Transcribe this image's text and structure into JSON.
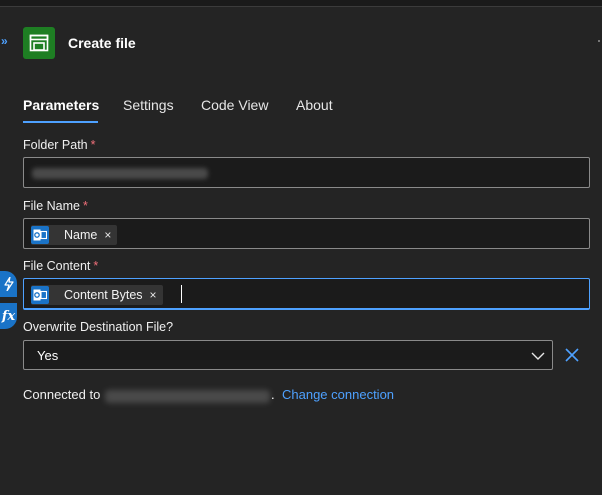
{
  "header": {
    "title": "Create file",
    "app_icon": "file-folder-icon",
    "collapse_icon": "double-chevron-icon"
  },
  "tabs": [
    {
      "label": "Parameters",
      "active": true
    },
    {
      "label": "Settings",
      "active": false
    },
    {
      "label": "Code View",
      "active": false
    },
    {
      "label": "About",
      "active": false
    }
  ],
  "fields": {
    "folder_path": {
      "label": "Folder Path",
      "required_mark": "*"
    },
    "file_name": {
      "label": "File Name",
      "required_mark": "*",
      "token": "Name",
      "token_remove": "×"
    },
    "file_content": {
      "label": "File Content",
      "required_mark": "*",
      "token": "Content Bytes",
      "token_remove": "×"
    },
    "overwrite": {
      "label": "Overwrite Destination File?",
      "value": "Yes"
    }
  },
  "connection": {
    "prefix": "Connected to",
    "suffix": ".",
    "link": "Change connection"
  },
  "colors": {
    "accent": "#4ea1ff",
    "app_icon_bg": "#1e7e23",
    "token_icon_bg": "#1a73c7",
    "required": "#f1707a"
  }
}
